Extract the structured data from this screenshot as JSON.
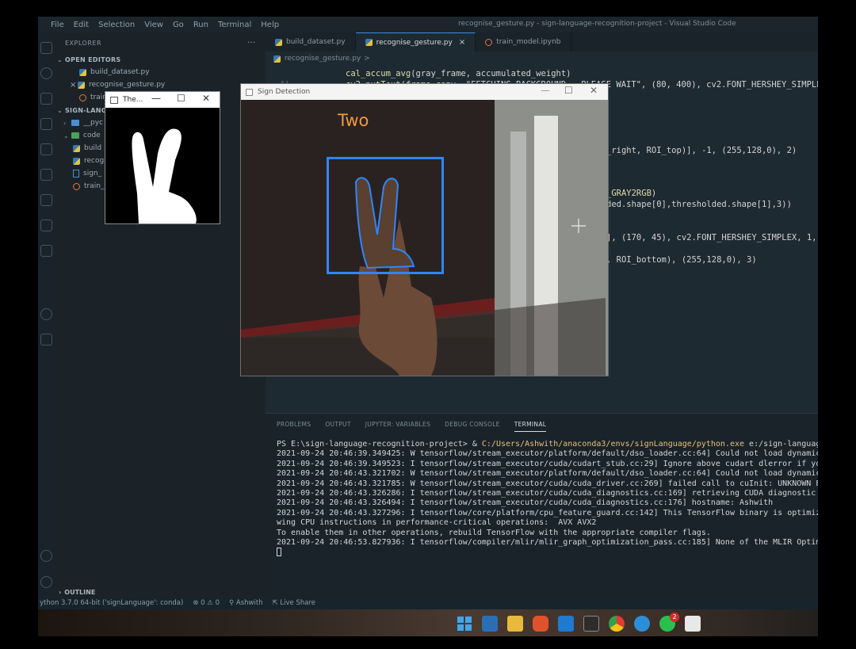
{
  "titlebar": {
    "menu": [
      "File",
      "Edit",
      "Selection",
      "View",
      "Go",
      "Run",
      "Terminal",
      "Help"
    ],
    "title": "recognise_gesture.py - sign-language-recognition-project - Visual Studio Code"
  },
  "sidebar": {
    "header": "EXPLORER",
    "more": "···",
    "open_editors_label": "OPEN EDITORS",
    "open_editors": [
      {
        "name": "build_dataset.py",
        "icon": "python"
      },
      {
        "name": "recognise_gesture.py",
        "icon": "python",
        "close": "×"
      },
      {
        "name": "train",
        "icon": "notebook"
      }
    ],
    "project_label": "SIGN-LANGU",
    "tree": [
      {
        "name": "__pyc",
        "icon": "folder"
      },
      {
        "name": "code",
        "icon": "folder-green"
      },
      {
        "name": "build",
        "icon": "python"
      },
      {
        "name": "recog",
        "icon": "python"
      },
      {
        "name": "sign_",
        "icon": "file"
      },
      {
        "name": "train_",
        "icon": "notebook"
      }
    ],
    "outline_label": "OUTLINE"
  },
  "tabs": [
    {
      "label": "build_dataset.py",
      "icon": "python"
    },
    {
      "label": "recognise_gesture.py",
      "icon": "python",
      "active": true,
      "close": "×"
    },
    {
      "label": "train_model.ipynb",
      "icon": "notebook"
    }
  ],
  "breadcrumb": {
    "file": "recognise_gesture.py",
    "sep": ">"
  },
  "code": {
    "ln_51": "51",
    "line1_fn": "cal_accum_avg",
    "line1_rest": "(gray_frame, accumulated_weight)",
    "line2_fn": "cv2.putText",
    "line2_rest": "(frame_copy, \"FETCHING BACKGROUND...PLEASE WAIT\", (80, 400), cv2.FONT_HERSHEY_SIMPLEX",
    "line3": "_right, ROI_top)], -1, (255,128,0), 2)",
    "line4": "_GRAY2RGB)",
    "line5": "ded.shape[0],thresholded.shape[1],3))",
    "line6": "], (170, 45), cv2.FONT_HERSHEY_SIMPLEX, 1,",
    "line7": ", ROI_bottom), (255,128,0), 3)"
  },
  "panel": {
    "tabs": [
      "PROBLEMS",
      "OUTPUT",
      "JUPYTER: VARIABLES",
      "DEBUG CONSOLE",
      "TERMINAL"
    ],
    "active_tab": "TERMINAL",
    "prompt": "PS E:\\sign-language-recognition-project> & ",
    "prompt_path": "C:/Users/Ashwith/anaconda3/envs/signLanguage/python.exe",
    "prompt_rest": " e:/sign-language-re",
    "lines": [
      "2021-09-24 20:46:39.349425: W tensorflow/stream_executor/platform/default/dso_loader.cc:64] Could not load dynamic lib",
      "2021-09-24 20:46:39.349523: I tensorflow/stream_executor/cuda/cudart_stub.cc:29] Ignore above cudart dlerror if you do",
      "2021-09-24 20:46:43.321702: W tensorflow/stream_executor/platform/default/dso_loader.cc:64] Could not load dynamic lib",
      "2021-09-24 20:46:43.321785: W tensorflow/stream_executor/cuda/cuda_driver.cc:269] failed call to cuInit: UNKNOWN ERROR",
      "2021-09-24 20:46:43.326286: I tensorflow/stream_executor/cuda/cuda_diagnostics.cc:169] retrieving CUDA diagnostic info",
      "2021-09-24 20:46:43.326494: I tensorflow/stream_executor/cuda/cuda_diagnostics.cc:176] hostname: Ashwith",
      "2021-09-24 20:46:43.327296: I tensorflow/core/platform/cpu_feature_guard.cc:142] This TensorFlow binary is optimized w",
      "wing CPU instructions in performance-critical operations:  AVX AVX2",
      "To enable them in other operations, rebuild TensorFlow with the appropriate compiler flags.",
      "2021-09-24 20:46:53.827936: I tensorflow/compiler/mlir/mlir_graph_optimization_pass.cc:185] None of the MLIR Optimizat"
    ]
  },
  "statusbar": {
    "python": "ython 3.7.0 64-bit ('signLanguage': conda)",
    "problems": "⊗ 0 ⚠ 0",
    "user": "Ashwith",
    "live_share": "Live Share"
  },
  "threshold_window": {
    "title": "The..."
  },
  "sign_window": {
    "title": "Sign Detection",
    "gesture": "Two"
  },
  "taskbar": {
    "chat_badge": "2"
  },
  "colors": {
    "accent": "#2f86ff",
    "label": "#ef9a3a",
    "editor_bg": "#1e2a31"
  }
}
